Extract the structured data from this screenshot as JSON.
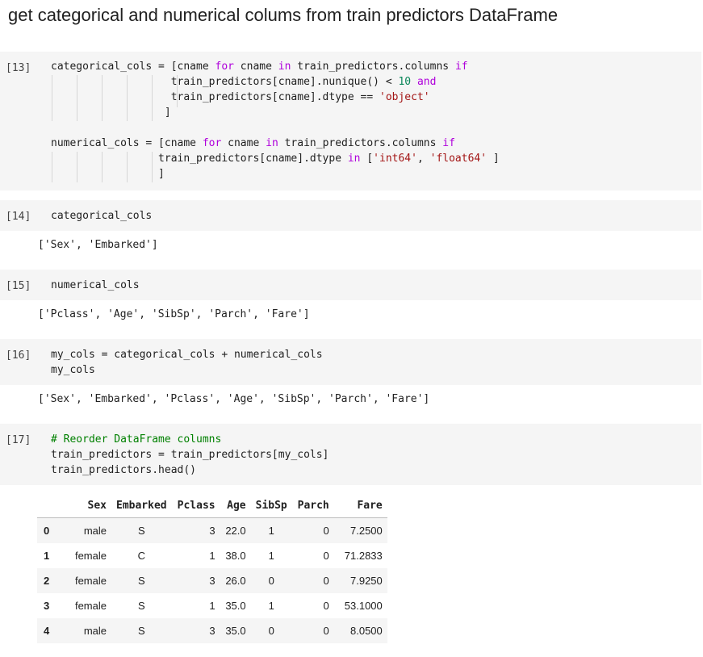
{
  "heading": "get categorical and numerical colums from train predictors DataFrame",
  "cells": [
    {
      "prompt": "[13]",
      "lines": [
        [
          [
            "categorical_cols = [cname ",
            ""
          ],
          [
            "for",
            "kw"
          ],
          [
            " cname ",
            ""
          ],
          [
            "in",
            "kw"
          ],
          [
            " train_predictors.columns ",
            ""
          ],
          [
            "if",
            "kw"
          ]
        ],
        [
          [
            "                   train_predictors[cname].nunique() < ",
            ""
          ],
          [
            "10",
            "num"
          ],
          [
            " ",
            ""
          ],
          [
            "and",
            "kw"
          ]
        ],
        [
          [
            "                   train_predictors[cname].dtype == ",
            ""
          ],
          [
            "'object'",
            "str"
          ]
        ],
        [
          [
            "                  ]",
            ""
          ]
        ],
        [
          [
            "",
            ""
          ]
        ],
        [
          [
            "numerical_cols = [cname ",
            ""
          ],
          [
            "for",
            "kw"
          ],
          [
            " cname ",
            ""
          ],
          [
            "in",
            "kw"
          ],
          [
            " train_predictors.columns ",
            ""
          ],
          [
            "if",
            "kw"
          ]
        ],
        [
          [
            "                 train_predictors[cname].dtype ",
            ""
          ],
          [
            "in",
            "kw"
          ],
          [
            " [",
            ""
          ],
          [
            "'int64'",
            "str"
          ],
          [
            ", ",
            ""
          ],
          [
            "'float64'",
            "str"
          ],
          [
            " ]",
            ""
          ]
        ],
        [
          [
            "                 ]",
            ""
          ]
        ]
      ]
    },
    {
      "prompt": "[14]",
      "lines": [
        [
          [
            "categorical_cols",
            ""
          ]
        ]
      ],
      "output": "['Sex', 'Embarked']"
    },
    {
      "prompt": "[15]",
      "lines": [
        [
          [
            "numerical_cols",
            ""
          ]
        ]
      ],
      "output": "['Pclass', 'Age', 'SibSp', 'Parch', 'Fare']"
    },
    {
      "prompt": "[16]",
      "lines": [
        [
          [
            "my_cols = categorical_cols + numerical_cols",
            ""
          ]
        ],
        [
          [
            "my_cols",
            ""
          ]
        ]
      ],
      "output": "['Sex', 'Embarked', 'Pclass', 'Age', 'SibSp', 'Parch', 'Fare']"
    },
    {
      "prompt": "[17]",
      "lines": [
        [
          [
            "# Reorder DataFrame columns",
            "cmt"
          ]
        ],
        [
          [
            "train_predictors = train_predictors[my_cols]",
            ""
          ]
        ],
        [
          [
            "train_predictors.head()",
            ""
          ]
        ]
      ]
    }
  ],
  "table": {
    "columns": [
      "",
      "Sex",
      "Embarked",
      "Pclass",
      "Age",
      "SibSp",
      "Parch",
      "Fare"
    ],
    "rows": [
      [
        "0",
        "male",
        "S",
        "3",
        "22.0",
        "1",
        "0",
        "7.2500"
      ],
      [
        "1",
        "female",
        "C",
        "1",
        "38.0",
        "1",
        "0",
        "71.2833"
      ],
      [
        "2",
        "female",
        "S",
        "3",
        "26.0",
        "0",
        "0",
        "7.9250"
      ],
      [
        "3",
        "female",
        "S",
        "1",
        "35.0",
        "1",
        "0",
        "53.1000"
      ],
      [
        "4",
        "male",
        "S",
        "3",
        "35.0",
        "0",
        "0",
        "8.0500"
      ]
    ]
  }
}
